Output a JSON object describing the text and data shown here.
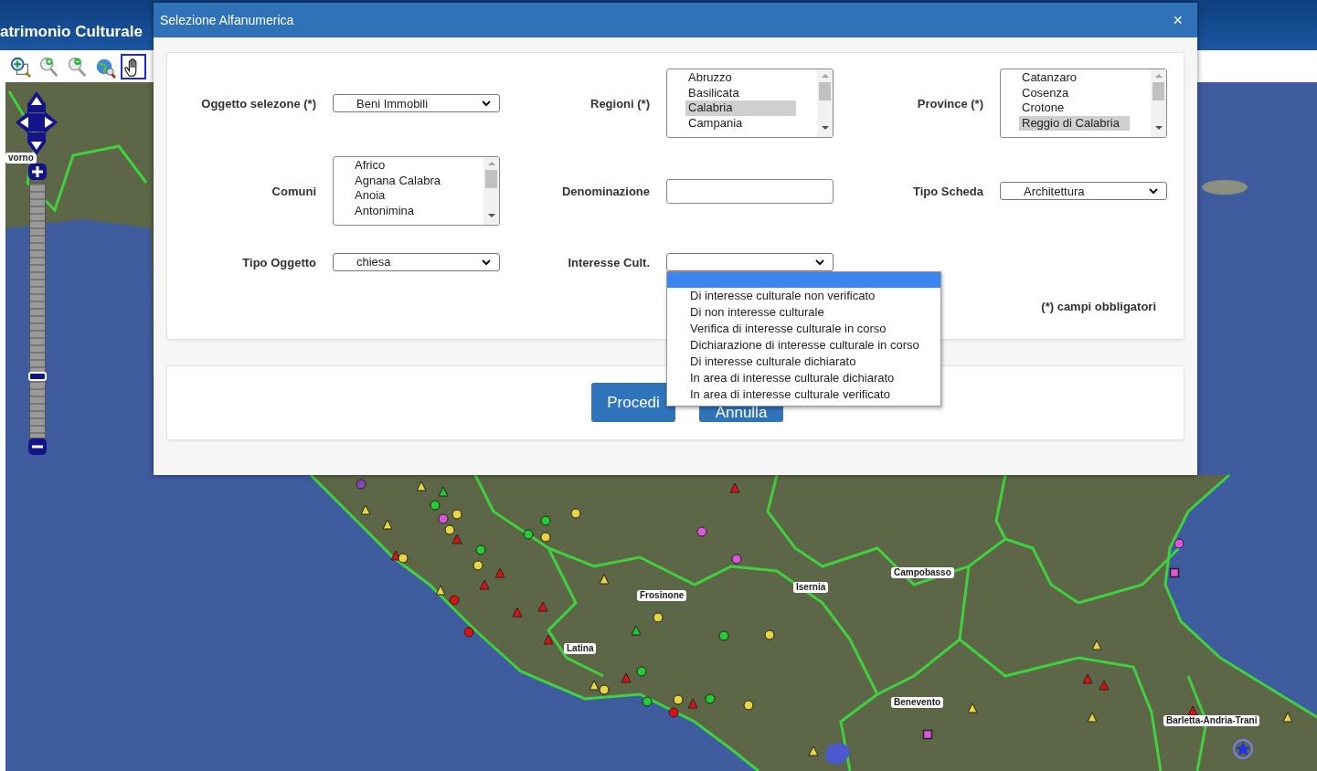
{
  "app": {
    "title": "atrimonio Culturale"
  },
  "toolbar": [
    {
      "selected": false
    },
    {
      "selected": false
    },
    {
      "selected": false
    },
    {
      "selected": false
    },
    {
      "selected": true
    }
  ],
  "map": {
    "labels": [
      "vorno",
      "Frosinone",
      "Latina",
      "Isernia",
      "Campobasso",
      "Benevento",
      "Barletta-Andria-Trani"
    ],
    "zoom": {
      "level": 0.24
    },
    "markers": [
      {
        "kind": "triangle",
        "color": "#e8d640"
      },
      {
        "kind": "triangle",
        "color": "#22cc33"
      },
      {
        "kind": "circle",
        "color": "#22cc33"
      },
      {
        "kind": "circle",
        "color": "#e8d640"
      },
      {
        "kind": "circle",
        "color": "#dd55dd"
      },
      {
        "kind": "circle",
        "color": "#e8d640"
      },
      {
        "kind": "triangle",
        "color": "#dd1111"
      },
      {
        "kind": "circle",
        "color": "#22cc33"
      },
      {
        "kind": "circle",
        "color": "#22cc33"
      },
      {
        "kind": "circle",
        "color": "#22cc33"
      },
      {
        "kind": "circle",
        "color": "#e8d640"
      },
      {
        "kind": "circle",
        "color": "#e8d640"
      },
      {
        "kind": "triangle",
        "color": "#dd1111"
      },
      {
        "kind": "circle",
        "color": "#e8d640"
      },
      {
        "kind": "triangle",
        "color": "#e8d640"
      },
      {
        "kind": "triangle",
        "color": "#e8d640"
      },
      {
        "kind": "circle",
        "color": "#e8d640"
      },
      {
        "kind": "triangle",
        "color": "#dd1111"
      },
      {
        "kind": "triangle",
        "color": "#dd1111"
      },
      {
        "kind": "circle",
        "color": "#dd1111"
      },
      {
        "kind": "triangle",
        "color": "#e8d640"
      },
      {
        "kind": "circle",
        "color": "#dd1111"
      },
      {
        "kind": "triangle",
        "color": "#dd1111"
      },
      {
        "kind": "triangle",
        "color": "#dd1111"
      },
      {
        "kind": "triangle",
        "color": "#dd1111"
      },
      {
        "kind": "triangle",
        "color": "#e8d640"
      },
      {
        "kind": "circle",
        "color": "#e8d640"
      },
      {
        "kind": "triangle",
        "color": "#22cc33"
      },
      {
        "kind": "circle",
        "color": "#22cc33"
      },
      {
        "kind": "circle",
        "color": "#e8d640"
      },
      {
        "kind": "triangle",
        "color": "#e8d640"
      },
      {
        "kind": "circle",
        "color": "#e8d640"
      },
      {
        "kind": "triangle",
        "color": "#dd1111"
      },
      {
        "kind": "circle",
        "color": "#22cc33"
      },
      {
        "kind": "circle",
        "color": "#22cc33"
      },
      {
        "kind": "circle",
        "color": "#e8d640"
      },
      {
        "kind": "circle",
        "color": "#dd1111"
      },
      {
        "kind": "triangle",
        "color": "#dd1111"
      },
      {
        "kind": "circle",
        "color": "#22cc33"
      },
      {
        "kind": "circle",
        "color": "#e8d640"
      },
      {
        "kind": "triangle",
        "color": "#e8d640"
      },
      {
        "kind": "triangle",
        "color": "#dd1111"
      },
      {
        "kind": "triangle",
        "color": "#dd1111"
      },
      {
        "kind": "triangle",
        "color": "#e8d640"
      },
      {
        "kind": "triangle",
        "color": "#e8d640"
      },
      {
        "kind": "triangle",
        "color": "#e8d640"
      },
      {
        "kind": "triangle",
        "color": "#dd1111"
      },
      {
        "kind": "triangle",
        "color": "#e8d640"
      },
      {
        "kind": "star",
        "color": "#1f33e6"
      },
      {
        "kind": "circle",
        "color": "#dd55dd"
      },
      {
        "kind": "square",
        "color": "#dd55dd"
      },
      {
        "kind": "square",
        "color": "#dd55dd"
      },
      {
        "kind": "circle",
        "color": "#dd55dd"
      },
      {
        "kind": "circle",
        "color": "#dd55dd"
      },
      {
        "kind": "triangle",
        "color": "#dd1111"
      },
      {
        "kind": "circle",
        "color": "#8844bb"
      }
    ]
  },
  "dialog": {
    "title": "Selezione Alfanumerica",
    "close": "×",
    "rows": [
      [
        {
          "kind": "select",
          "label": "Oggetto selezone (*)",
          "value": "Beni Immobili"
        },
        {
          "kind": "listbox",
          "label": "Regioni (*)",
          "options": [
            {
              "text": "Abruzzo",
              "selected": false
            },
            {
              "text": "Basilicata",
              "selected": false
            },
            {
              "text": "Calabria",
              "selected": true
            },
            {
              "text": "Campania",
              "selected": false
            }
          ]
        },
        {
          "kind": "listbox",
          "label": "Province (*)",
          "options": [
            {
              "text": "Catanzaro",
              "selected": false
            },
            {
              "text": "Cosenza",
              "selected": false
            },
            {
              "text": "Crotone",
              "selected": false
            },
            {
              "text": "Reggio di Calabria",
              "selected": true
            }
          ]
        }
      ],
      [
        {
          "kind": "listbox",
          "label": "Comuni",
          "options": [
            {
              "text": "Africo",
              "selected": false
            },
            {
              "text": "Agnana Calabra",
              "selected": false
            },
            {
              "text": "Anoia",
              "selected": false
            },
            {
              "text": "Antonimina",
              "selected": false
            }
          ]
        },
        {
          "kind": "text",
          "label": "Denominazione"
        },
        {
          "kind": "select",
          "label": "Tipo Scheda",
          "value": "Architettura"
        }
      ],
      [
        {
          "kind": "select",
          "label": "Tipo Oggetto",
          "value": "chiesa"
        },
        {
          "kind": "select",
          "label": "Interesse Cult.",
          "open": true,
          "options": [
            {
              "selected": true
            },
            {
              "text": "Di interesse culturale non verificato",
              "selected": false
            },
            {
              "text": "Di non interesse culturale",
              "selected": false
            },
            {
              "text": "Verifica di interesse culturale in corso",
              "selected": false
            },
            {
              "text": "Dichiarazione di interesse culturale in corso",
              "selected": false
            },
            {
              "text": "Di interesse culturale dichiarato",
              "selected": false
            },
            {
              "text": "In area di interesse culturale dichiarato",
              "selected": false
            },
            {
              "text": "In area di interesse culturale verificato",
              "selected": false
            }
          ]
        }
      ]
    ],
    "note": "(*) campi obbligatori",
    "buttons": [
      "Procedi",
      "Annulla"
    ]
  }
}
